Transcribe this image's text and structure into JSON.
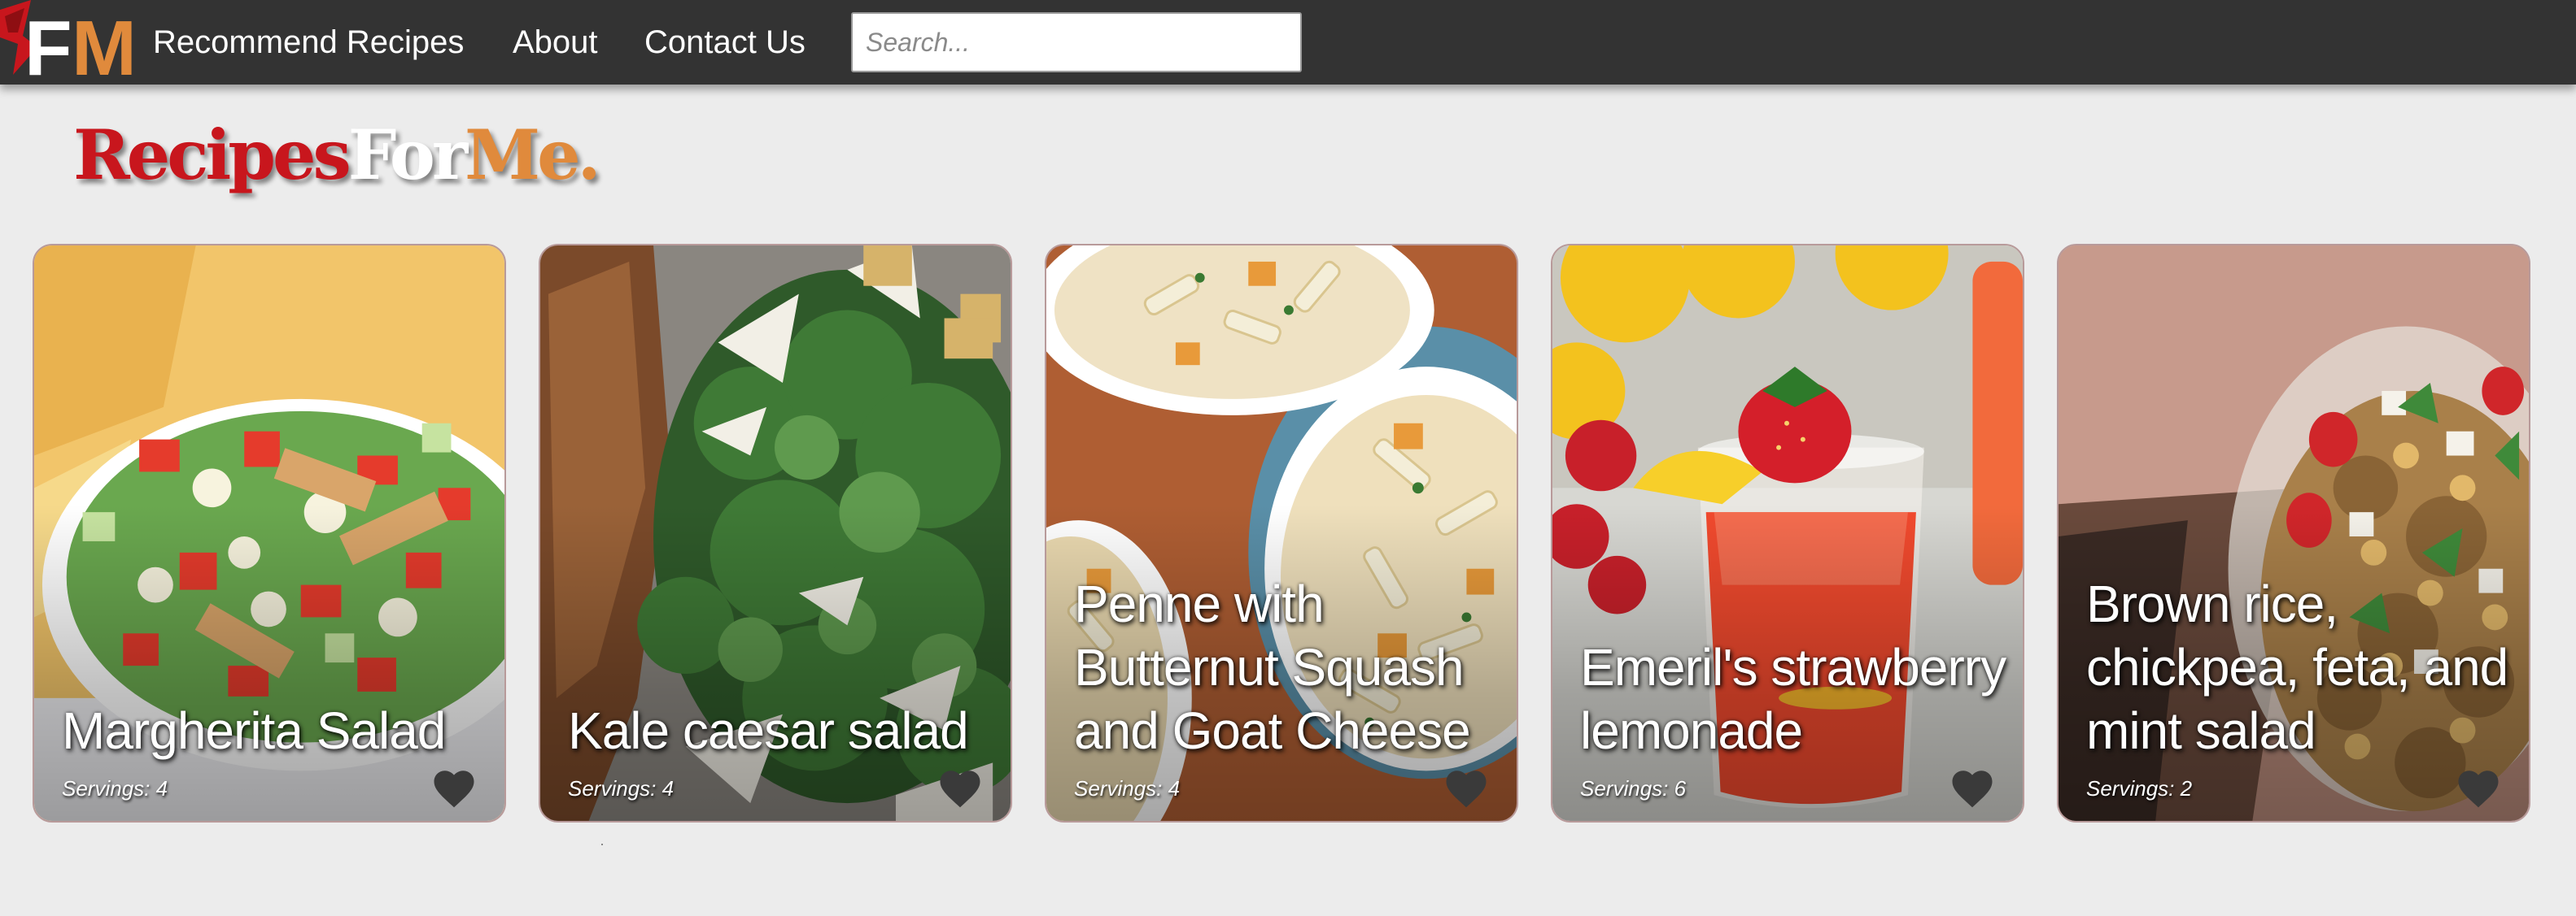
{
  "nav": {
    "logo_text": "FM",
    "links": [
      "Recommend Recipes",
      "About",
      "Contact Us"
    ],
    "search_placeholder": "Search..."
  },
  "brand": {
    "part1": "Recipes",
    "part2": "For",
    "part3": "Me."
  },
  "recipes": [
    {
      "title": "Margherita Salad",
      "servings": "Servings: 4"
    },
    {
      "title": "Kale caesar salad",
      "servings": "Servings: 4"
    },
    {
      "title": "Penne with Butternut Squash and Goat Cheese",
      "servings": "Servings: 4"
    },
    {
      "title": "Emeril's strawberry lemonade",
      "servings": "Servings: 6"
    },
    {
      "title": "Brown rice, chickpea, feta, and mint salad",
      "servings": "Servings: 2"
    }
  ],
  "colors": {
    "navbar": "#333333",
    "page_bg": "#ececec",
    "brand_red": "#c8161d",
    "brand_orange": "#e08a3c",
    "heart": "#3a3a3a"
  },
  "icons": {
    "heart": "heart-icon",
    "logo": "fm-logo"
  }
}
